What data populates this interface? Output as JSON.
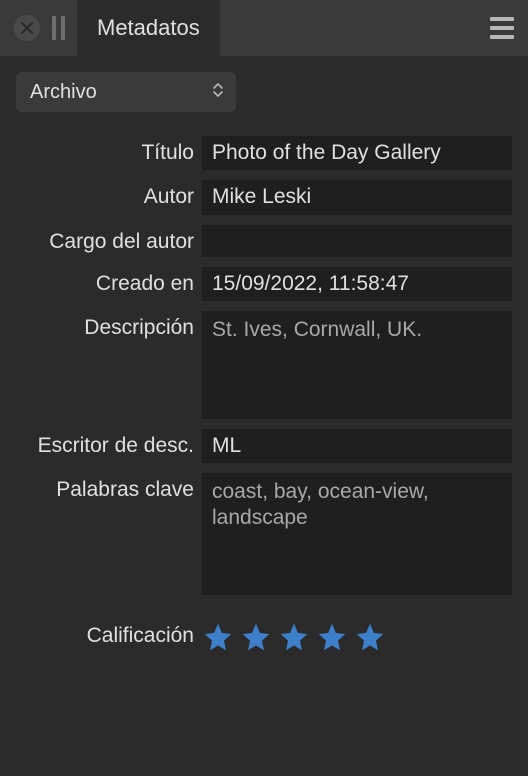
{
  "header": {
    "tab_label": "Metadatos"
  },
  "dropdown": {
    "selected": "Archivo"
  },
  "fields": {
    "titulo_label": "Título",
    "titulo_value": "Photo of the Day Gallery",
    "autor_label": "Autor",
    "autor_value": "Mike Leski",
    "cargo_label": "Cargo del autor",
    "cargo_value": "",
    "creado_label": "Creado en",
    "creado_value": "15/09/2022,  11:58:47",
    "descripcion_label": "Descripción",
    "descripcion_value": "St. Ives, Cornwall, UK.",
    "escritor_label": "Escritor de desc.",
    "escritor_value": "ML",
    "palabras_label": "Palabras clave",
    "palabras_value": "coast, bay, ocean-view, landscape",
    "calificacion_label": "Calificación",
    "rating": 5
  }
}
